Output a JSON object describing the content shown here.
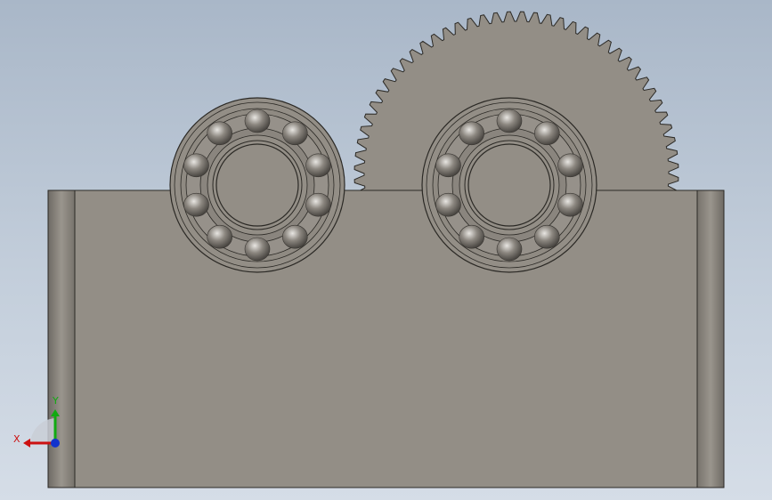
{
  "viewport": {
    "background_top": "#a9b7c8",
    "background_bottom": "#d5dde7",
    "part_color": "#938e86",
    "edge_color": "#2b2925",
    "ball_color": "#8c8780"
  },
  "scene": {
    "gear": {
      "teeth": 76
    },
    "bearings": [
      {
        "name": "left-bearing",
        "balls": 10
      },
      {
        "name": "right-bearing",
        "balls": 10
      }
    ]
  },
  "triad": {
    "x_label": "X",
    "y_label": "Y",
    "x_color": "#cc1111",
    "y_color": "#11aa11",
    "z_color": "#1133cc"
  }
}
